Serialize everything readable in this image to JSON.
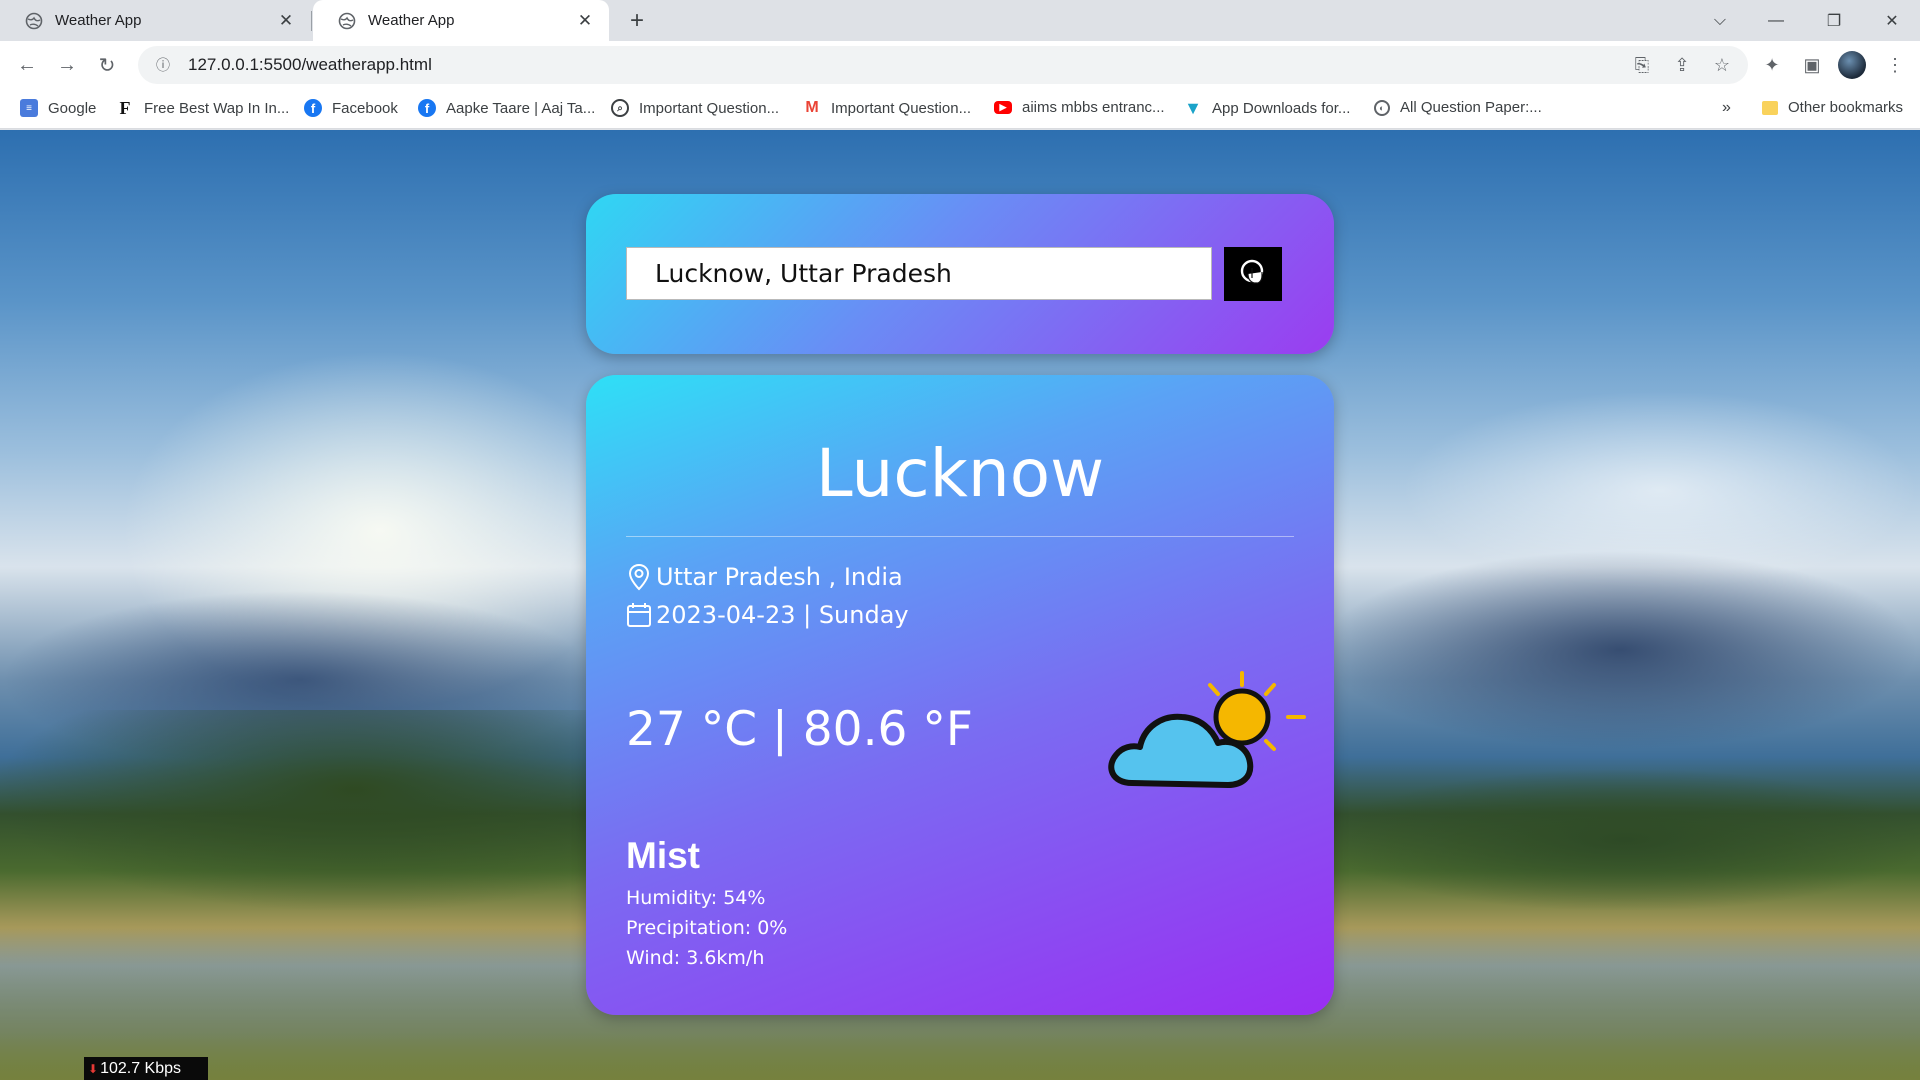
{
  "browser": {
    "tabs": [
      {
        "title": "Weather App",
        "active": false
      },
      {
        "title": "Weather App",
        "active": true
      }
    ],
    "url": "127.0.0.1:5500/weatherapp.html",
    "bookmarks": [
      {
        "label": "Google",
        "icon": "google-docs-icon"
      },
      {
        "label": "Free Best Wap In In...",
        "icon": "f-letter-icon"
      },
      {
        "label": "Facebook",
        "icon": "facebook-icon"
      },
      {
        "label": "Aapke Taare | Aaj Ta...",
        "icon": "facebook-icon"
      },
      {
        "label": "Important Question...",
        "icon": "search-page-icon"
      },
      {
        "label": "Important Question...",
        "icon": "gmail-icon"
      },
      {
        "label": "aiims mbbs entranc...",
        "icon": "youtube-icon"
      },
      {
        "label": "App Downloads for...",
        "icon": "app-store-icon"
      },
      {
        "label": "All Question Paper:...",
        "icon": "globe-icon"
      }
    ],
    "other_bookmarks": "Other bookmarks",
    "overflow": "»"
  },
  "search": {
    "value": "Lucknow, Uttar Pradesh"
  },
  "weather": {
    "city": "Lucknow",
    "location": "Uttar Pradesh , India",
    "date": "2023-04-23 | Sunday",
    "temperature": "27 °C | 80.6 °F",
    "condition": "Mist",
    "humidity": "Humidity: 54%",
    "precipitation": "Precipitation: 0%",
    "wind": "Wind: 3.6km/h",
    "icon": "partly-cloudy-icon"
  },
  "netspeed": "102.7 Kbps",
  "colors": {
    "card_gradient_start": "#2fd7f3",
    "card_gradient_end": "#9b3cf0",
    "search_button": "#000000"
  }
}
